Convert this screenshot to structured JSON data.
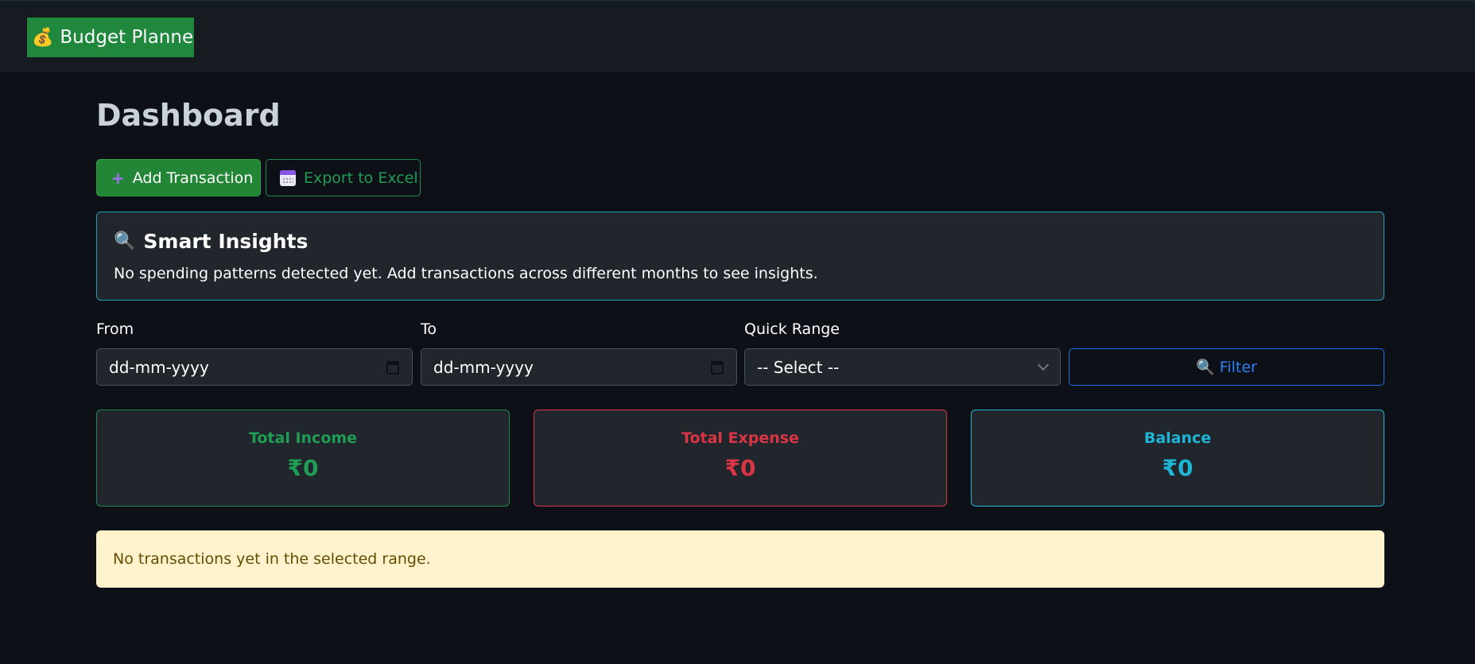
{
  "navbar": {
    "brand_icon": "money-bag-icon",
    "brand_label": "Budget Planner",
    "brand_color": "#1f883d"
  },
  "page": {
    "title": "Dashboard"
  },
  "actions": {
    "add_label": "Add Transaction",
    "add_icon": "plus-icon",
    "export_label": "Export to Excel",
    "export_icon": "calendar-icon"
  },
  "insights": {
    "icon": "magnifier-icon",
    "title": "Smart Insights",
    "text": "No spending patterns detected yet. Add transactions across different months to see insights."
  },
  "filters": {
    "from_label": "From",
    "from_value": "dd-mm-yyyy",
    "to_label": "To",
    "to_value": "dd-mm-yyyy",
    "range_label": "Quick Range",
    "range_value": "-- Select --",
    "filter_label": "Filter"
  },
  "summary": [
    {
      "title": "Total Income",
      "value": "₹0",
      "color": "#1f9d55"
    },
    {
      "title": "Total Expense",
      "value": "₹0",
      "color": "#da3445"
    },
    {
      "title": "Balance",
      "value": "₹0",
      "color": "#1fb6d6"
    }
  ],
  "alert": {
    "text": "No transactions yet in the selected range.",
    "bg": "#fff3cd"
  }
}
